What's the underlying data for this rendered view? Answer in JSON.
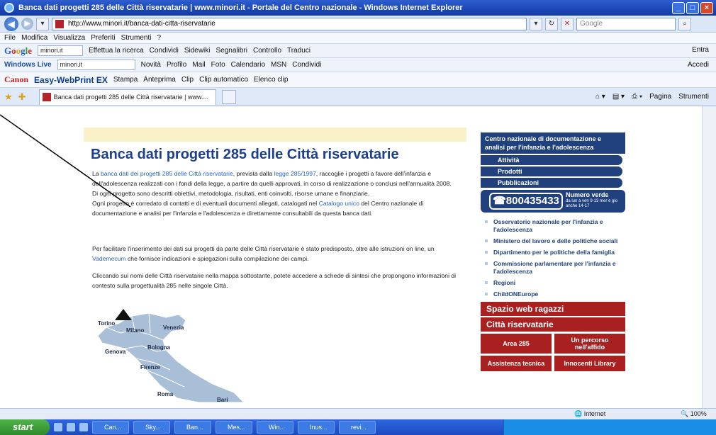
{
  "window": {
    "title": "Banca dati progetti 285 delle Città riservatarie | www.minori.it - Portale del Centro nazionale - Windows Internet Explorer"
  },
  "address": {
    "url": "http://www.minori.it/banca-dati-citta-riservatarie",
    "search_placeholder": "Google"
  },
  "menu": [
    "File",
    "Modifica",
    "Visualizza",
    "Preferiti",
    "Strumenti",
    "?"
  ],
  "google_toolbar": {
    "logo_letters": [
      "G",
      "o",
      "o",
      "g",
      "l",
      "e"
    ],
    "input_value": "minori.it",
    "items": [
      "Effettua la ricerca",
      "Condividi",
      "Sidewiki",
      "Segnalibri",
      "Controllo",
      "Traduci"
    ],
    "right_items": [
      "Entra"
    ]
  },
  "live_toolbar": {
    "label": "Windows Live",
    "input_value": "minori.it",
    "items": [
      "Novità",
      "Profilo",
      "Mail",
      "Foto",
      "Calendario",
      "MSN",
      "Condividi"
    ],
    "right_items": [
      "Accedi"
    ]
  },
  "canon_toolbar": {
    "brand": "Canon",
    "product": "Easy-WebPrint EX",
    "items": [
      "Stampa",
      "Anteprima",
      "Clip",
      "Clip automatico",
      "Elenco clip"
    ]
  },
  "tabs": {
    "active_label": "Banca dati progetti 285 delle Città riservatarie | www....",
    "right_items": [
      "Pagina",
      "Strumenti"
    ]
  },
  "page": {
    "title": "Banca dati progetti 285 delle Città riservatarie",
    "p1_pre": "La ",
    "p1_link": "banca dati dei progetti 285 delle Città riservatarie",
    "p1_mid": ", prevista dalla ",
    "p1_law": "legge 285/1997",
    "p1_post": ", raccoglie i progetti a favore dell'infanzia e dell'adolescenza realizzati con i fondi della legge, a partire da quelli approvati, in corso di realizzazione o conclusi nell'annualità 2008.",
    "p1_b": "Di ogni progetto sono descritti obiettivi, metodologia, risultati, enti coinvolti, risorse umane e finanziarie.",
    "p1_c_pre": "Ogni progetto è corredato di contatti e di eventuali documenti allegati, catalogati nel ",
    "p1_c_link": "Catalogo unico",
    "p1_c_post": " del Centro nazionale di documentazione e analisi per l'infanzia e l'adolescenza e direttamente consultabili da questa banca dati.",
    "p2_pre": "Per facilitare l'inserimento dei dati sui progetti da parte delle Città riservatarie è stato predisposto, oltre alle istruzioni on line, un ",
    "p2_link": "Vademecum",
    "p2_post": " che fornisce indicazioni e spiegazioni sulla compilazione dei campi.",
    "p3": "Cliccando sui nomi delle Città riservatarie nella mappa sottostante, potete accedere a schede di sintesi che propongono informazioni di contesto sulla progettualità 285 nelle singole Città."
  },
  "map": {
    "cities": [
      "Torino",
      "Milano",
      "Venezia",
      "Genova",
      "Bologna",
      "Firenze",
      "Roma",
      "Bari"
    ]
  },
  "sidebar": {
    "header": "Centro nazionale di documentazione e analisi per l'infanzia e l'adolescenza",
    "items": [
      "Attività",
      "Prodotti",
      "Pubblicazioni"
    ],
    "phone_number": "800435433",
    "phone_label": "Numero verde",
    "phone_hours": "da lun a ven 9-13 mer e gio anche 14-17",
    "links": [
      "Osservatorio nazionale per l'infanzia e l'adolescenza",
      "Ministero del lavoro e delle politiche sociali",
      "Dipartimento per le politiche della famiglia",
      "Commissione parlamentare per l'infanzia e l'adolescenza",
      "Regioni",
      "ChildONEurope"
    ],
    "banner1": "Spazio web ragazzi",
    "banner2": "Città riservatarie",
    "cells": [
      "Area 285",
      "Un percorso nell'affido",
      "Assistenza tecnica",
      "Innocenti Library"
    ]
  },
  "status": {
    "zone": "Internet",
    "zoom": "100%"
  },
  "taskbar": {
    "start": "start",
    "tasks": [
      "Can...",
      "Sky...",
      "Ban...",
      "Mes...",
      "Win...",
      "Inus...",
      "revi..."
    ]
  },
  "colors": {
    "accent": "#20417e",
    "red": "#a82020",
    "link": "#2862c9"
  }
}
